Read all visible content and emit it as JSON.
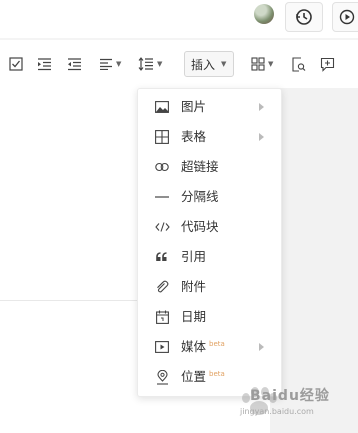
{
  "toolbar": {
    "insert_label": "插入"
  },
  "insert_menu": {
    "items": [
      {
        "label": "图片",
        "icon": "image-icon",
        "has_submenu": true,
        "beta": ""
      },
      {
        "label": "表格",
        "icon": "table-icon",
        "has_submenu": true,
        "beta": ""
      },
      {
        "label": "超链接",
        "icon": "link-icon",
        "has_submenu": false,
        "beta": ""
      },
      {
        "label": "分隔线",
        "icon": "divider-icon",
        "has_submenu": false,
        "beta": ""
      },
      {
        "label": "代码块",
        "icon": "code-icon",
        "has_submenu": false,
        "beta": ""
      },
      {
        "label": "引用",
        "icon": "quote-icon",
        "has_submenu": false,
        "beta": ""
      },
      {
        "label": "附件",
        "icon": "paperclip-icon",
        "has_submenu": false,
        "beta": ""
      },
      {
        "label": "日期",
        "icon": "calendar-icon",
        "has_submenu": false,
        "beta": ""
      },
      {
        "label": "媒体",
        "icon": "media-icon",
        "has_submenu": true,
        "beta": "beta"
      },
      {
        "label": "位置",
        "icon": "location-icon",
        "has_submenu": false,
        "beta": "beta"
      }
    ]
  },
  "watermark": {
    "brand": "Baidu经验",
    "url": "jingyan.baidu.com"
  }
}
